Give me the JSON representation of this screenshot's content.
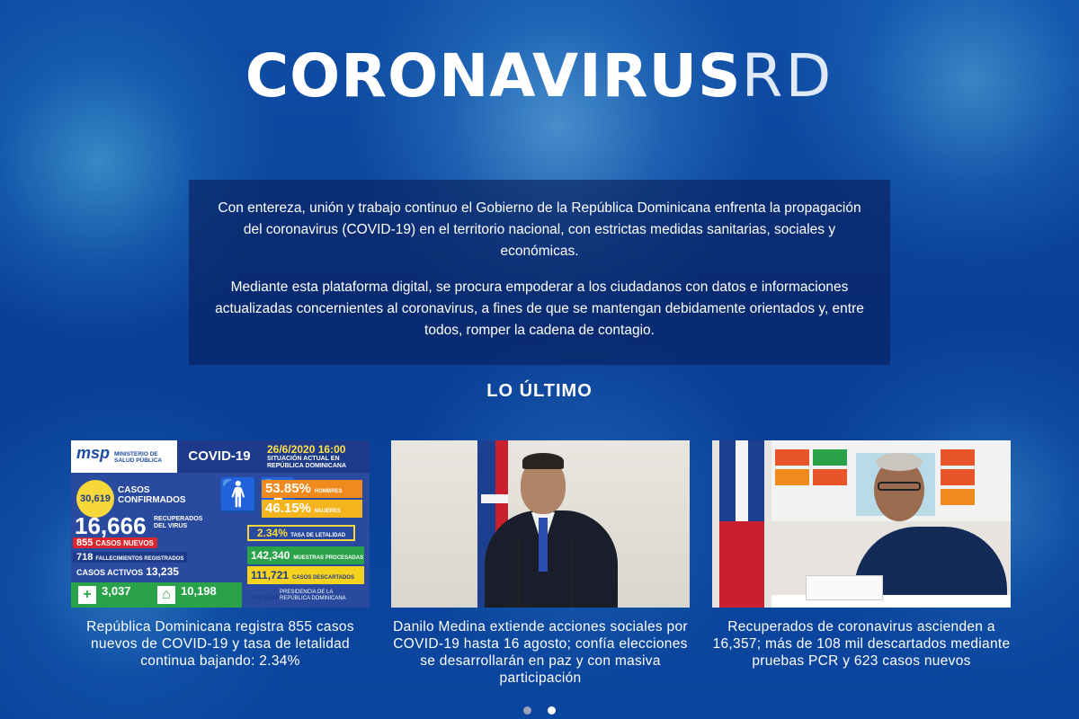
{
  "header": {
    "title_bold": "CORONAVIRUS",
    "title_light": "RD"
  },
  "intro": {
    "paragraph1": "Con entereza, unión y trabajo continuo el Gobierno de la República Dominicana enfrenta la propagación del coronavirus (COVID-19) en el territorio nacional, con estrictas medidas sanitarias, sociales y económicas.",
    "paragraph2": "Mediante esta plataforma digital, se procura empoderar a los ciudadanos con datos e informaciones actualizadas concernientes al coronavirus, a fines de que se mantengan debidamente orientados y, entre todos, romper la cadena de contagio."
  },
  "latest": {
    "section_title": "LO ÚLTIMO",
    "cards": [
      {
        "caption": "República Dominicana registra 855 casos nuevos de COVID-19 y tasa de letalidad continua bajando: 2.34%"
      },
      {
        "caption": "Danilo Medina extiende acciones sociales por COVID-19 hasta 16 agosto; confía elecciones se desarrollarán en paz y con masiva participación"
      },
      {
        "caption": "Recuperados de coronavirus ascienden a 16,357; más de 108 mil descartados mediante pruebas PCR y 623 casos nuevos"
      }
    ]
  },
  "infographic": {
    "logo": "msp",
    "ministry": "MINISTERIO DE SALUD PÚBLICA",
    "label": "COVID-19",
    "date": "26/6/2020 16:00",
    "subtitle": "SITUACIÓN ACTUAL EN REPÚBLICA DOMINICANA",
    "confirmed": "30,619",
    "confirmed_label": "CASOS CONFIRMADOS",
    "recovered": "16,666",
    "recovered_label": "RECUPERADOS DEL VIRUS",
    "new_cases": "855",
    "new_cases_label": "CASOS NUEVOS",
    "deaths": "718",
    "deaths_label": "FALLECIMIENTOS REGISTRADOS",
    "active_label": "CASOS ACTIVOS",
    "active": "13,235",
    "men_pct": "53.85%",
    "men_label": "HOMBRES",
    "women_pct": "46.15%",
    "women_label": "MUJERES",
    "lethality": "2.34%",
    "lethality_label": "TASA DE LETALIDAD",
    "pcr": "142,340",
    "pcr_label": "MUESTRAS PROCESADAS PCR",
    "discarded": "111,721",
    "discarded_label": "CASOS DESCARTADOS POR LABORATORIO",
    "hospital": "3,037",
    "home": "10,198",
    "presidency": "PRESIDENCIA DE LA REPÚBLICA DOMINICANA"
  },
  "carousel": {
    "active_index": 1,
    "dot_colors": [
      "#9aa3b8",
      "#ffffff"
    ]
  }
}
